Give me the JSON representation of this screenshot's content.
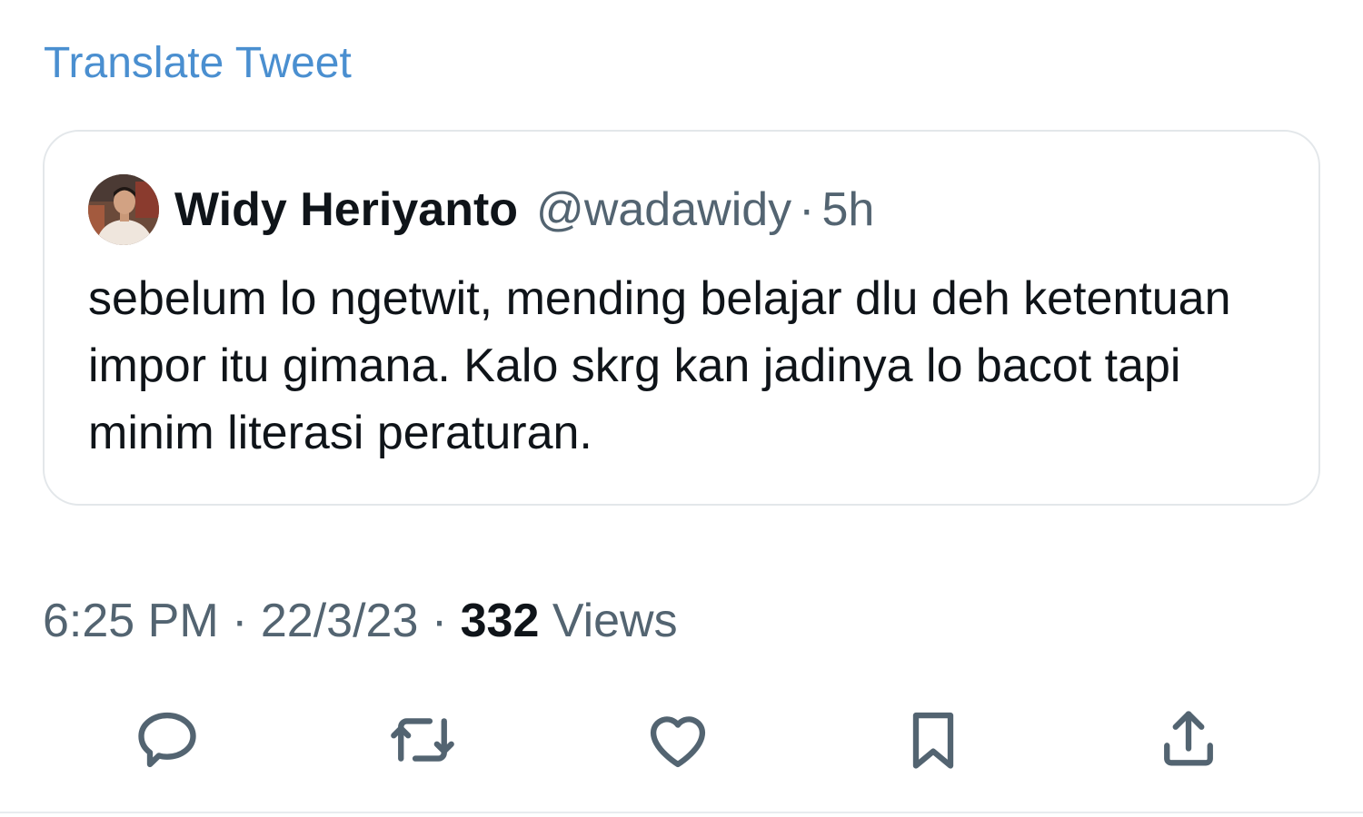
{
  "translate_link": "Translate Tweet",
  "quoted_tweet": {
    "author_name": "Widy Heriyanto",
    "author_handle": "@wadawidy",
    "separator": "·",
    "time_ago": "5h",
    "text": "sebelum lo ngetwit, mending belajar dlu deh ketentuan impor itu gimana. Kalo skrg kan jadinya lo bacot tapi minim literasi peraturan."
  },
  "meta": {
    "time": "6:25 PM",
    "separator": "·",
    "date": "22/3/23",
    "views_count": "332",
    "views_label": "Views"
  },
  "actions": [
    {
      "icon": "reply-icon",
      "label": "Reply"
    },
    {
      "icon": "retweet-icon",
      "label": "Retweet"
    },
    {
      "icon": "heart-icon",
      "label": "Like"
    },
    {
      "icon": "bookmark-icon",
      "label": "Bookmark"
    },
    {
      "icon": "share-icon",
      "label": "Share"
    }
  ],
  "colors": {
    "link": "#4a8fd0",
    "primary_text": "#0f1419",
    "secondary_text": "#536471",
    "border": "#e3e7ea"
  }
}
